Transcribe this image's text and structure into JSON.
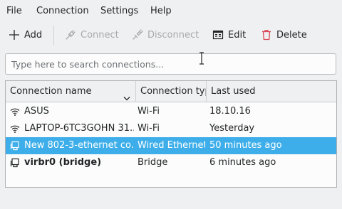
{
  "menu": [
    "File",
    "Connection",
    "Settings",
    "Help"
  ],
  "toolbar": {
    "add": "Add",
    "connect": "Connect",
    "disconnect": "Disconnect",
    "edit": "Edit",
    "delete": "Delete"
  },
  "search": {
    "placeholder": "Type here to search connections..."
  },
  "table": {
    "columns": [
      "Connection name",
      "Connection typ",
      "Last used"
    ],
    "rows": [
      {
        "name": "ASUS",
        "type": "Wi-Fi",
        "last_used": "18.10.16",
        "icon": "wifi-icon"
      },
      {
        "name": "LAPTOP-6TC3GOHN 31...",
        "type": "Wi-Fi",
        "last_used": "Yesterday",
        "icon": "wifi-icon"
      },
      {
        "name": "New 802-3-ethernet co...",
        "type": "Wired Ethernet",
        "last_used": "50 minutes ago",
        "icon": "ethernet-icon",
        "selected": true
      },
      {
        "name": "virbr0 (bridge)",
        "type": "Bridge",
        "last_used": "6 minutes ago",
        "icon": "ethernet-icon",
        "bold": true
      }
    ]
  },
  "colors": {
    "selection": "#3daee9",
    "delete": "#da4453",
    "window_bg": "#eff0f1"
  }
}
